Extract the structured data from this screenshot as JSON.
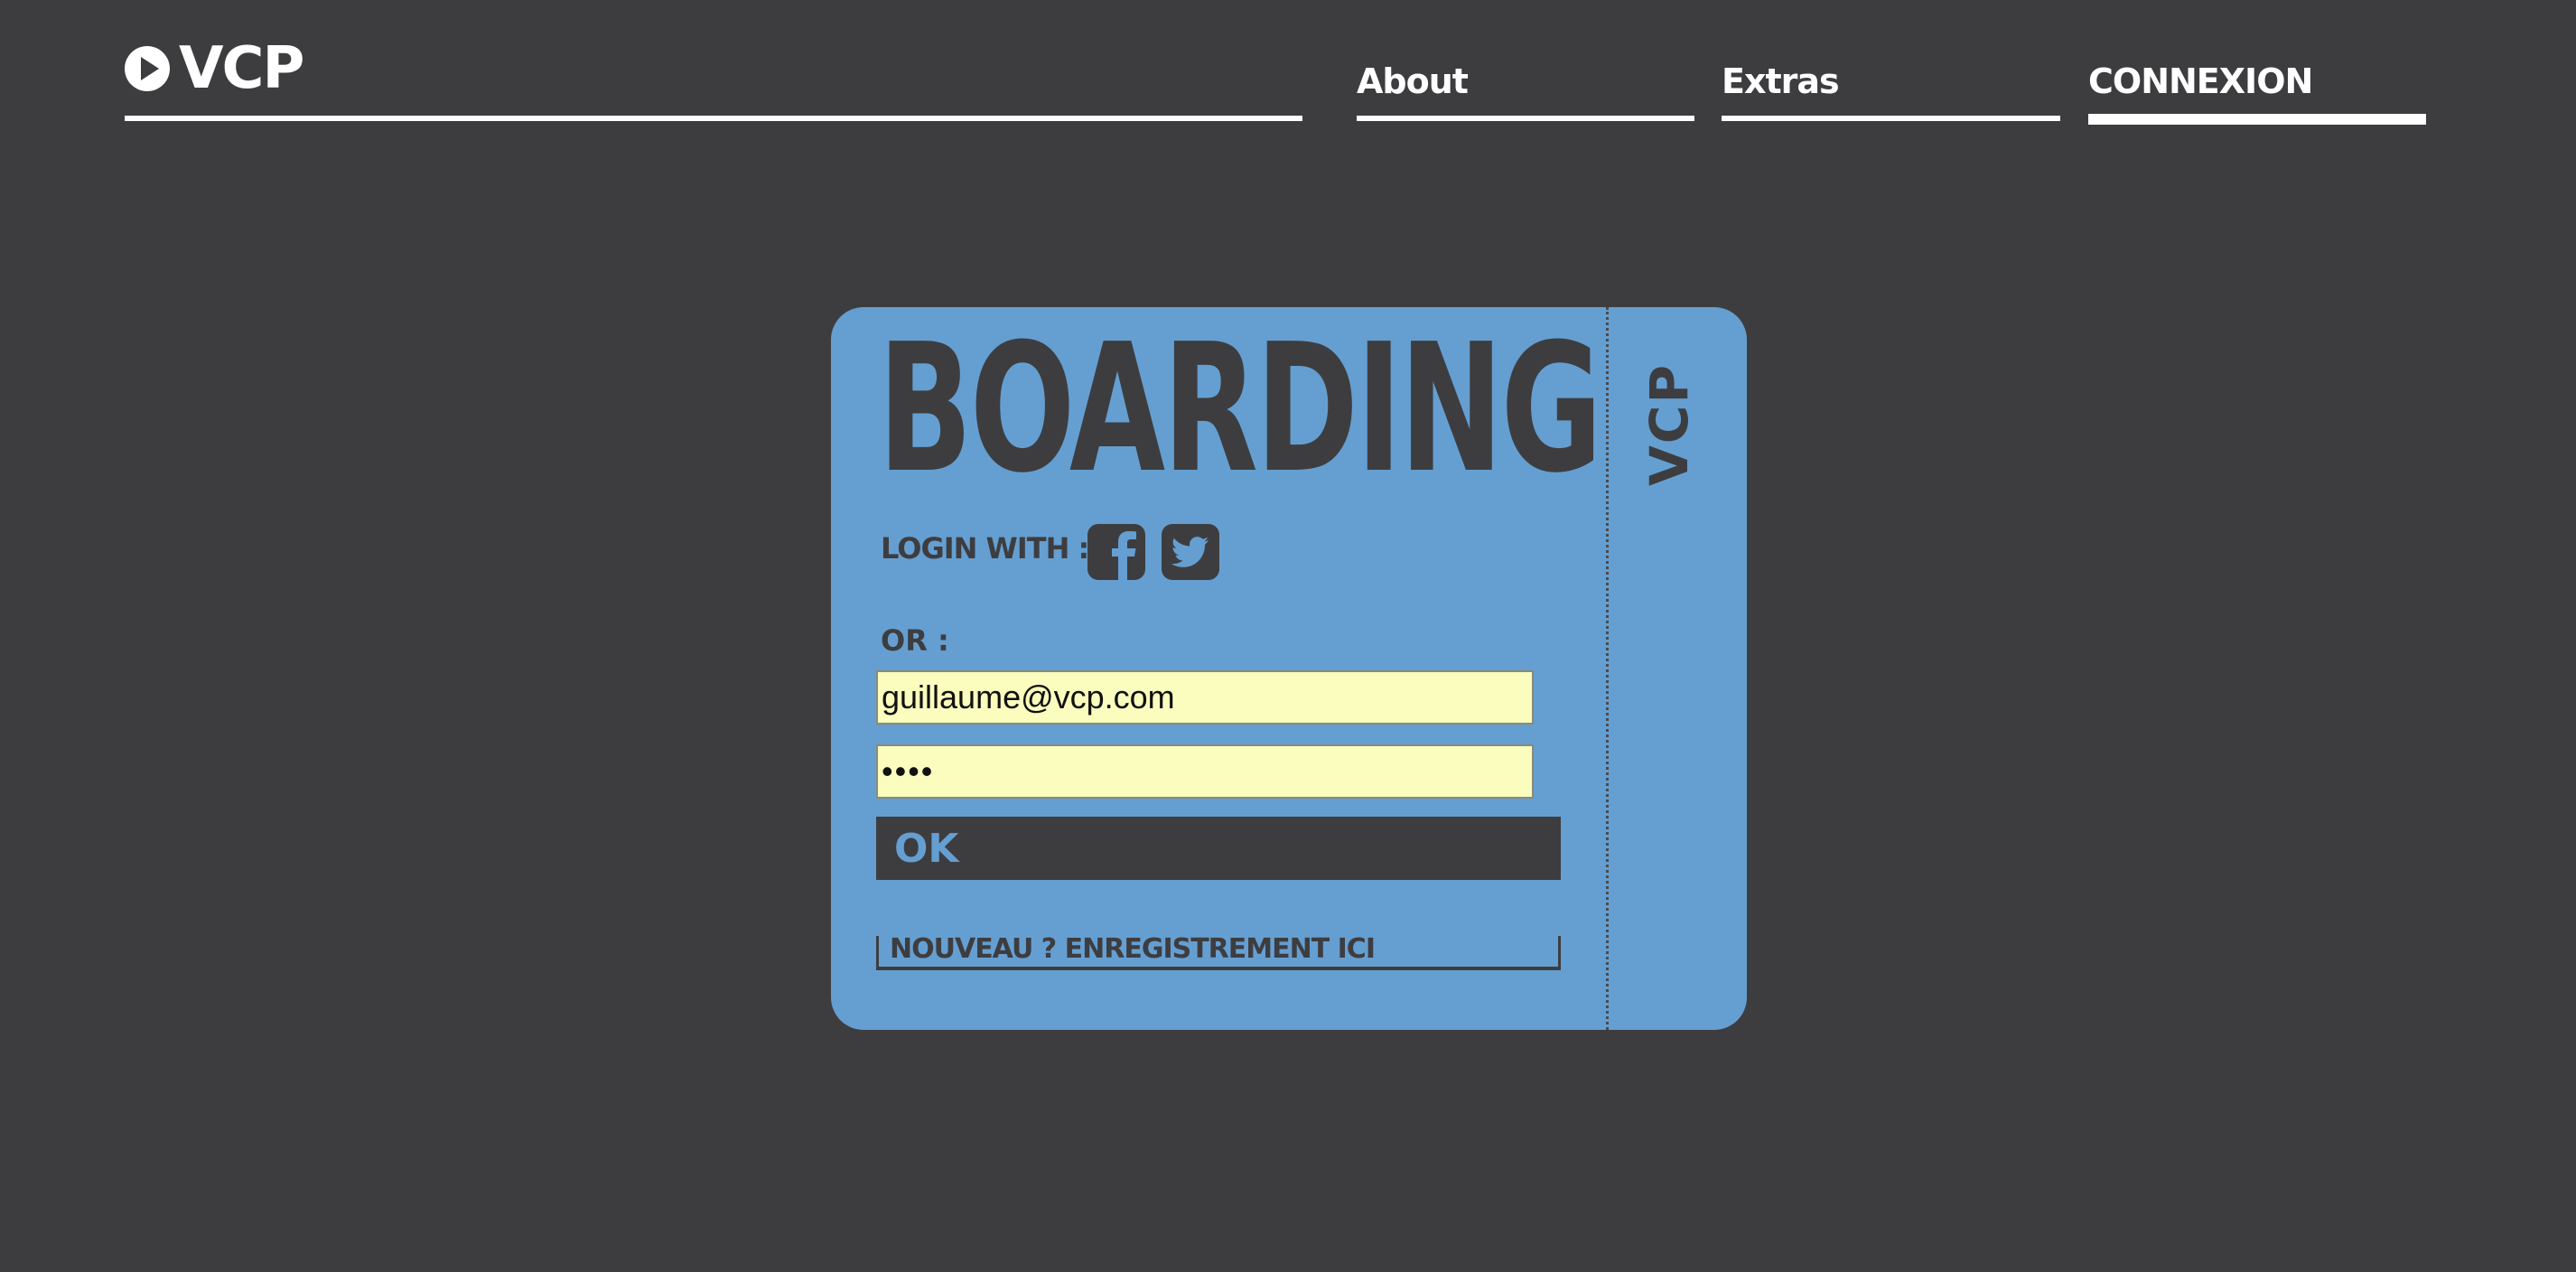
{
  "header": {
    "brand_name": "VCP",
    "brand_icon": "play-circle-icon",
    "nav": [
      {
        "label": "About",
        "active": false
      },
      {
        "label": "Extras",
        "active": false
      },
      {
        "label": "CONNEXION",
        "active": true
      }
    ]
  },
  "ticket": {
    "title": "BOARDING",
    "stub_text": "VCP",
    "login_with_label": "LOGIN WITH :",
    "social_icons": [
      "facebook-icon",
      "twitter-icon"
    ],
    "or_label": "OR :",
    "email_value": "guillaume@vcp.com",
    "password_value": "••••",
    "ok_label": "OK",
    "register_label": "NOUVEAU ? ENREGISTREMENT ICI"
  },
  "colors": {
    "background": "#3d3d40",
    "ticket": "#659fd1",
    "input_fill": "#fafdbd",
    "text_dark": "#3d3d40",
    "text_light": "#ffffff"
  }
}
